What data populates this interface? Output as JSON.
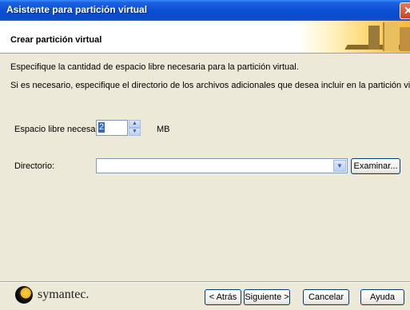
{
  "window": {
    "title": "Asistente para partición virtual",
    "close_symbol": "✕"
  },
  "header": {
    "title": "Crear partición virtual",
    "graphic_icon": "bookshelf-graphic"
  },
  "body": {
    "instruction_1": "Especifique la cantidad de espacio libre necesaria para la partición virtual.",
    "instruction_2": "Si es necesario, especifique el directorio de los archivos adicionales que desea incluir en la partición virtual."
  },
  "space": {
    "label": "Espacio libre necesario:",
    "value": "2",
    "unit": "MB"
  },
  "directory": {
    "label": "Directorio:",
    "value": "",
    "browse_label": "Examinar..."
  },
  "footer": {
    "brand": "symantec.",
    "back_label": "< Atrás",
    "next_label": "Siguiente >",
    "cancel_label": "Cancelar",
    "help_label": "Ayuda"
  },
  "colors": {
    "title_bar": "#0a4fd6",
    "dialog_bg": "#ece9d8",
    "selection": "#316ac5"
  }
}
